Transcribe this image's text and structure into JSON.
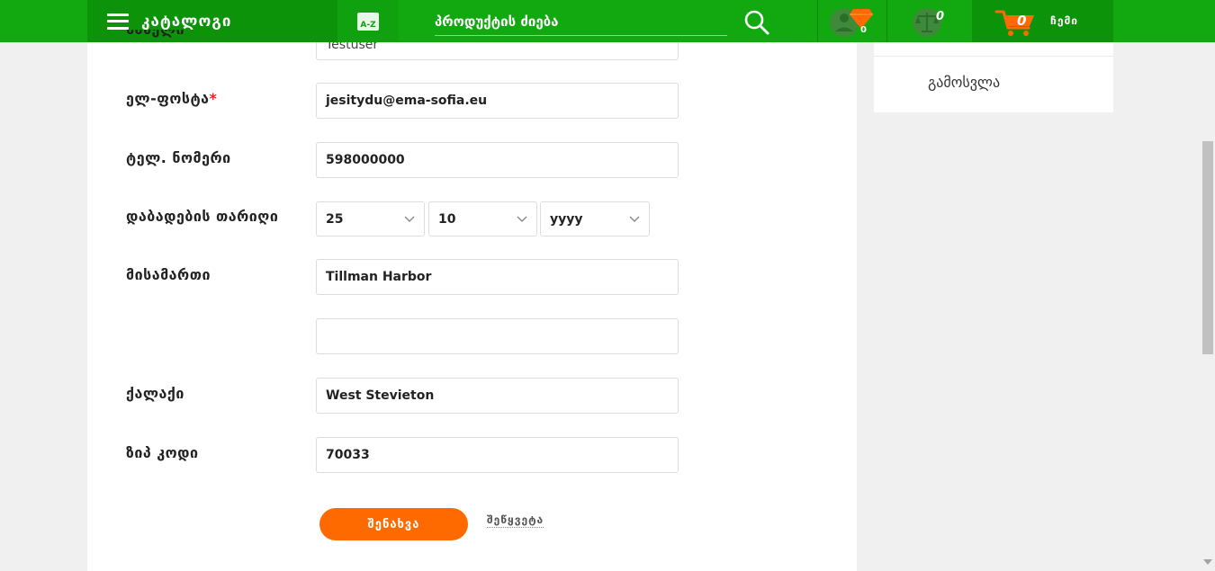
{
  "header": {
    "catalog_label": "კატალოგი",
    "az_label": "A-Z",
    "search_placeholder": "პროდუქტის ძიება",
    "favorites_count": "0",
    "compare_count": "0",
    "cart_count": "0",
    "mine_label": "ჩემი"
  },
  "form": {
    "partial_label": "სახელი",
    "partial_value": "Testuser",
    "email_label": "ელ-ფოსტა",
    "email_required": "*",
    "email_value": "jesitydu@ema-sofia.eu",
    "phone_label": "ტელ. ნომერი",
    "phone_value": "598000000",
    "birth_label": "დაბადების თარიღი",
    "birth_day": "25",
    "birth_month": "10",
    "birth_year": "yyyy",
    "address_label": "მისამართი",
    "address_line1": "Tillman Harbor",
    "address_line2": "",
    "city_label": "ქალაქი",
    "city_value": "West Stevieton",
    "zip_label": "ზიპ კოდი",
    "zip_value": "70033",
    "save_label": "შენახვა",
    "cancel_label": "შეწყვეტა"
  },
  "sidebar": {
    "logout_label": "გამოსვლა"
  },
  "colors": {
    "header_green": "#12a80f",
    "accent_orange": "#ff6a00",
    "required_red": "#e0251b"
  }
}
